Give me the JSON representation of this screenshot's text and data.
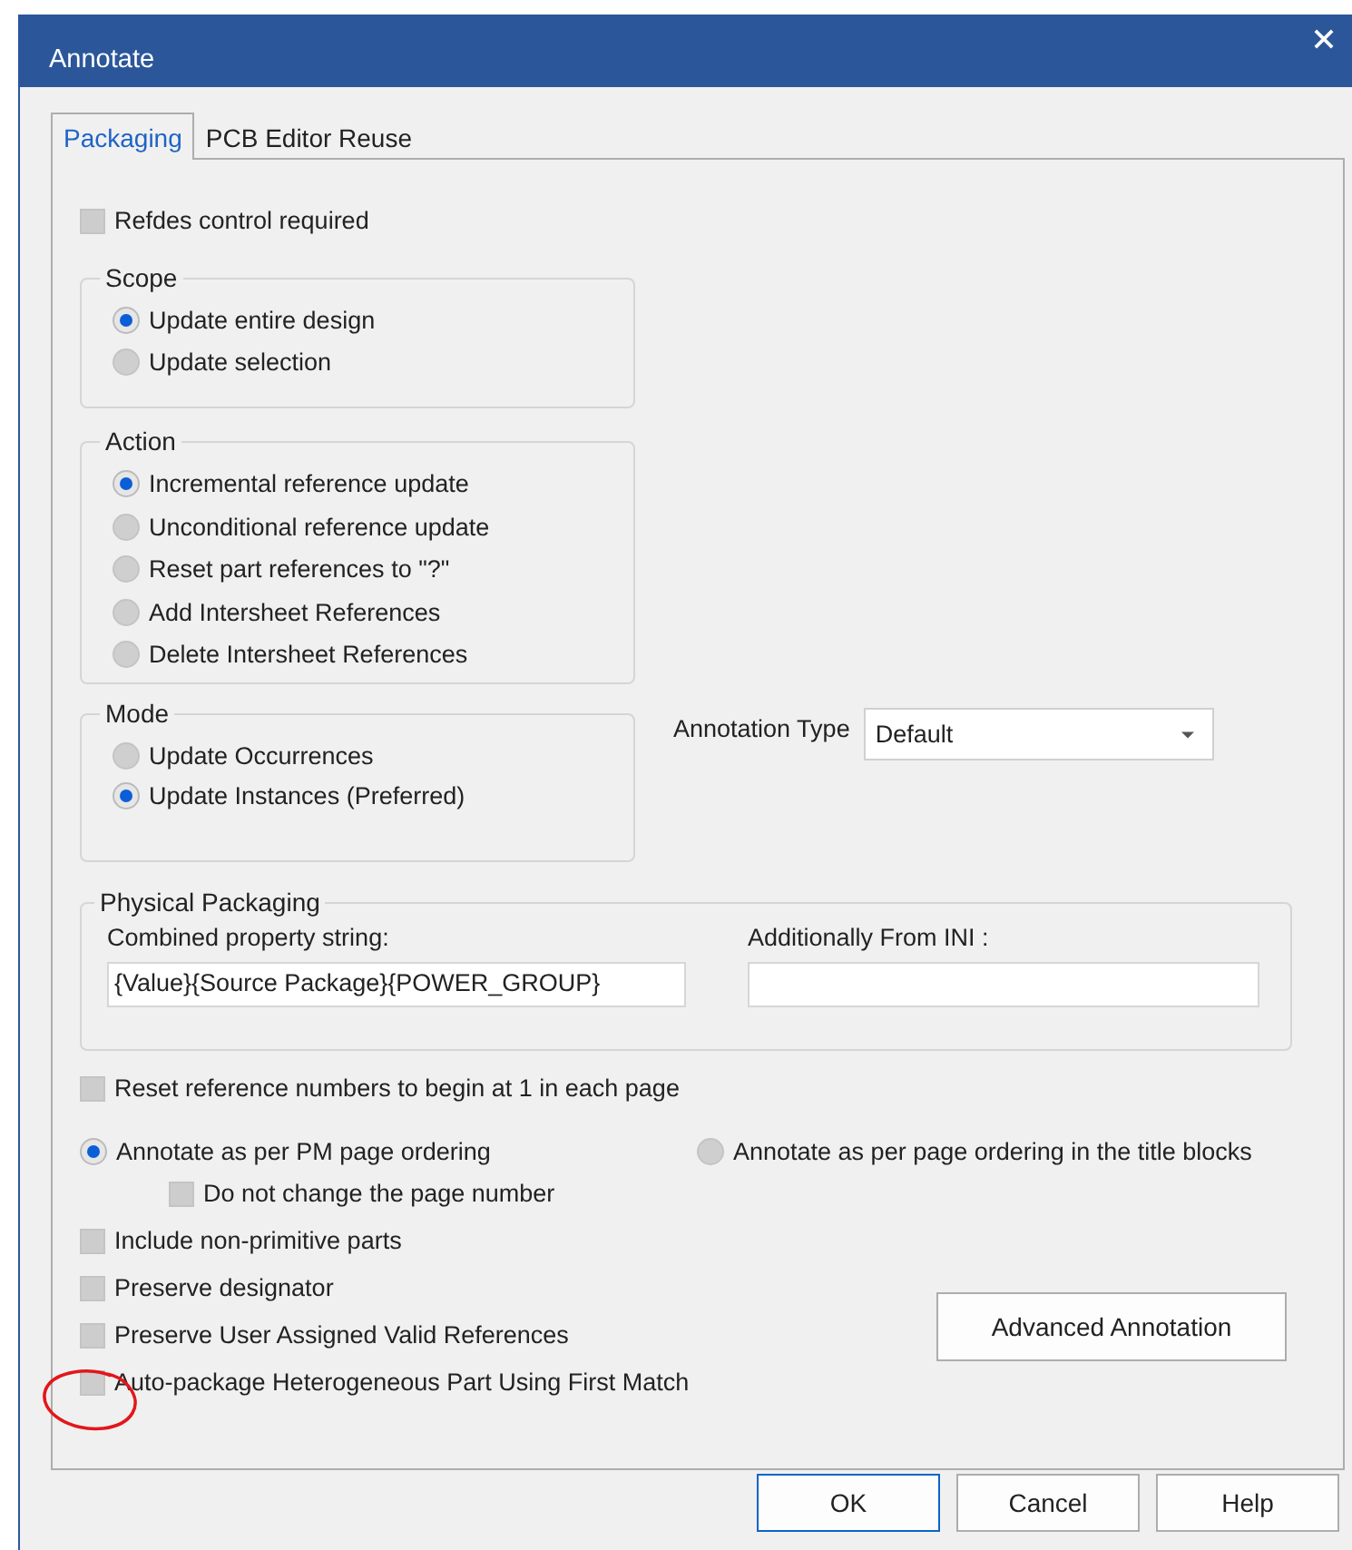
{
  "window": {
    "title": "Annotate"
  },
  "tabs": [
    {
      "label": "Packaging",
      "selected": true
    },
    {
      "label": "PCB Editor Reuse",
      "selected": false
    }
  ],
  "refdes": {
    "label": "Refdes control required",
    "checked": false
  },
  "scope": {
    "title": "Scope",
    "options": [
      {
        "label": "Update entire design",
        "selected": true
      },
      {
        "label": "Update selection",
        "selected": false
      }
    ]
  },
  "action": {
    "title": "Action",
    "options": [
      {
        "label": "Incremental reference update",
        "selected": true
      },
      {
        "label": "Unconditional reference update",
        "selected": false
      },
      {
        "label": "Reset part references to \"?\"",
        "selected": false
      },
      {
        "label": "Add Intersheet References",
        "selected": false
      },
      {
        "label": "Delete Intersheet References",
        "selected": false
      }
    ]
  },
  "mode": {
    "title": "Mode",
    "options": [
      {
        "label": "Update Occurrences",
        "selected": false
      },
      {
        "label": "Update Instances (Preferred)",
        "selected": true
      }
    ]
  },
  "annotation_type": {
    "label": "Annotation Type",
    "value": "Default"
  },
  "physical_packaging": {
    "title": "Physical Packaging",
    "fields": [
      {
        "label": "Combined property string:",
        "value": "{Value}{Source Package}{POWER_GROUP}"
      },
      {
        "label": "Additionally From INI :"
      }
    ]
  },
  "reset_numbers": {
    "label": "Reset reference numbers to begin at 1 in each page",
    "checked": false
  },
  "ordering": [
    {
      "label": "Annotate as per PM page ordering",
      "selected": true
    },
    {
      "label": "Annotate as per page ordering in the title blocks",
      "selected": false
    }
  ],
  "keep_page_number": {
    "label": "Do not change the page number",
    "checked": false
  },
  "options": [
    {
      "label": "Include non-primitive parts",
      "checked": false
    },
    {
      "label": "Preserve designator",
      "checked": false
    },
    {
      "label": "Preserve User Assigned Valid References",
      "checked": false
    },
    {
      "label": "Auto-package Heterogeneous Part Using First Match",
      "checked": false
    }
  ],
  "advanced_button": {
    "label": "Advanced Annotation"
  },
  "buttons": [
    {
      "label": "OK",
      "default": true
    },
    {
      "label": "Cancel",
      "default": false
    },
    {
      "label": "Help",
      "default": false
    }
  ]
}
